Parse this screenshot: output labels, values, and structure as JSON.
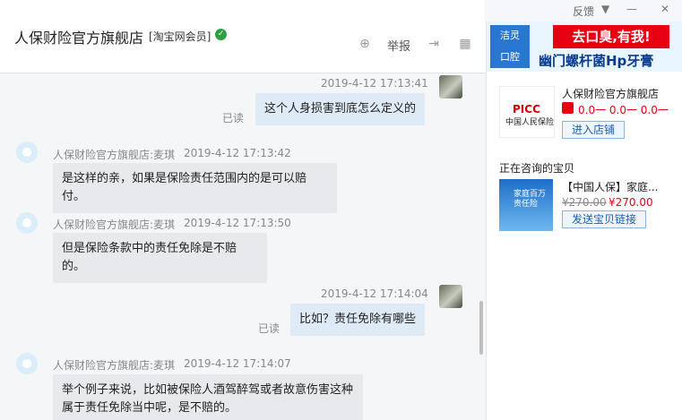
{
  "window": {
    "feedback": "反馈",
    "menu_glyph": "▼",
    "minimize_glyph": "—",
    "close_glyph": "✕"
  },
  "header": {
    "shop_name": "人保财险官方旗舰店",
    "member_tag": "[淘宝网会员]",
    "report_label": "举报",
    "icons": [
      "add-contact-icon",
      "share-icon",
      "grid-icon"
    ]
  },
  "messages": [
    {
      "from": "me",
      "time": "2019-4-12 17:13:41",
      "text": "这个人身损害到底怎么定义的",
      "status": "已读"
    },
    {
      "from": "them",
      "sender": "人保财险官方旗舰店:麦琪",
      "time": "2019-4-12 17:13:42",
      "text": "是这样的亲，如果是保险责任范围内的是可以赔付。"
    },
    {
      "from": "them",
      "sender": "人保财险官方旗舰店:麦琪",
      "time": "2019-4-12 17:13:50",
      "text": "但是保险条款中的责任免除是不赔的。"
    },
    {
      "from": "me",
      "time": "2019-4-12 17:14:04",
      "text": "比如？责任免除有哪些",
      "status": "已读"
    },
    {
      "from": "them",
      "sender": "人保财险官方旗舰店:麦琪",
      "time": "2019-4-12 17:14:07",
      "text": "举个例子来说，比如被保险人酒驾醉驾或者故意伤害这种属于责任免除当中呢，是不赔的。"
    }
  ],
  "sidebar": {
    "ad": {
      "brand": "洁灵",
      "brand_sub": "口腔",
      "headline": "去口臭,有我!",
      "subline": "幽门螺杆菌Hp牙膏"
    },
    "shop": {
      "logo_text": "PICC",
      "logo_sub": "中国人民保险",
      "name": "人保财险官方旗舰店",
      "rating": "0.0一  0.0一  0.0一",
      "enter_button": "进入店铺"
    },
    "consulting_label": "正在咨询的宝贝",
    "product": {
      "image_text": "家庭百万责任险",
      "title": "【中国人保】家庭...",
      "old_price": "¥270.00",
      "new_price": "¥270.00",
      "send_link_button": "发送宝贝链接"
    }
  }
}
